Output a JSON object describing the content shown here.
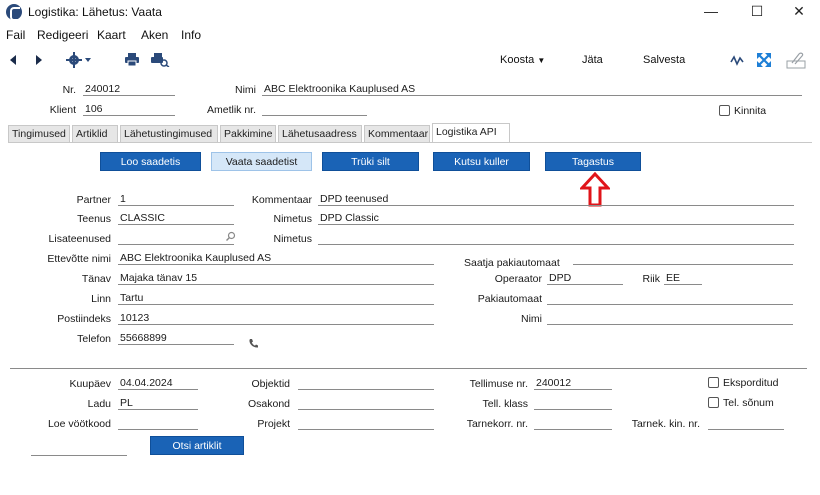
{
  "window": {
    "title": "Logistika: Lähetus: Vaata",
    "minimize": "—",
    "maximize": "☐",
    "close": "✕"
  },
  "menu": [
    "Fail",
    "Redigeeri",
    "Kaart",
    "Aken",
    "Info"
  ],
  "toolbar": {
    "koosta": "Koosta",
    "jata": "Jäta",
    "salvesta": "Salvesta"
  },
  "header": {
    "nr_label": "Nr.",
    "nr_value": "240012",
    "nimi_label": "Nimi",
    "nimi_value": "ABC Elektroonika Kauplused AS",
    "klient_label": "Klient",
    "klient_value": "106",
    "ametlik_label": "Ametlik nr.",
    "ametlik_value": "",
    "kinnita_label": "Kinnita"
  },
  "tabs": [
    "Tingimused",
    "Artiklid",
    "Lähetustingimused",
    "Pakkimine",
    "Lähetusaadress",
    "Kommentaar",
    "Logistika API"
  ],
  "active_tab": "Logistika API",
  "actions": [
    "Loo saadetis",
    "Vaata saadetist",
    "Trüki silt",
    "Kutsu kuller",
    "Tagastus"
  ],
  "api": {
    "partner_label": "Partner",
    "partner_value": "1",
    "kommentaar_label": "Kommentaar",
    "kommentaar_value": "DPD teenused",
    "teenus_label": "Teenus",
    "teenus_value": "CLASSIC",
    "nimetus_label": "Nimetus",
    "nimetus_value": "DPD Classic",
    "lisateenused_label": "Lisateenused",
    "lisateenused_value": "",
    "nimetus2_label": "Nimetus",
    "nimetus2_value": "",
    "ettevote_label": "Ettevõtte nimi",
    "ettevote_value": "ABC Elektroonika Kauplused AS",
    "tanav_label": "Tänav",
    "tanav_value": "Majaka tänav 15",
    "linn_label": "Linn",
    "linn_value": "Tartu",
    "postiindeks_label": "Postiindeks",
    "postiindeks_value": "10123",
    "telefon_label": "Telefon",
    "telefon_value": "55668899",
    "saatja_title": "Saatja pakiautomaat",
    "operaator_label": "Operaator",
    "operaator_value": "DPD",
    "riik_label": "Riik",
    "riik_value": "EE",
    "pakiautomaat_label": "Pakiautomaat",
    "pakiautomaat_value": "",
    "nimi_label": "Nimi",
    "nimi_value": ""
  },
  "footer": {
    "kuupaev_label": "Kuupäev",
    "kuupaev_value": "04.04.2024",
    "objektid_label": "Objektid",
    "objektid_value": "",
    "tellimuse_label": "Tellimuse nr.",
    "tellimuse_value": "240012",
    "eksporditud_label": "Eksporditud",
    "ladu_label": "Ladu",
    "ladu_value": "PL",
    "osakond_label": "Osakond",
    "osakond_value": "",
    "tell_klass_label": "Tell. klass",
    "tell_klass_value": "",
    "tel_sonum_label": "Tel. sõnum",
    "loe_label": "Loe vöötkood",
    "loe_value": "",
    "projekt_label": "Projekt",
    "projekt_value": "",
    "tarnekorr_label": "Tarnekorr. nr.",
    "tarnekorr_value": "",
    "tarnek_kin_label": "Tarnek. kin. nr.",
    "tarnek_kin_value": "",
    "otsi_label": "Otsi artiklit"
  },
  "colors": {
    "button_blue": "#1a63b6",
    "button_light": "#d5e7f8",
    "arrow_red": "#e0141a",
    "toolbar_icon": "#2b4a7a",
    "expand_icon": "#1e7fd6"
  },
  "icons": [
    "app-icon",
    "back-icon",
    "forward-icon",
    "gear-icon",
    "print-icon",
    "print-preview-icon",
    "activity-icon",
    "expand-icon",
    "attach-icon",
    "search-icon",
    "phone-icon",
    "up-arrow-icon"
  ]
}
